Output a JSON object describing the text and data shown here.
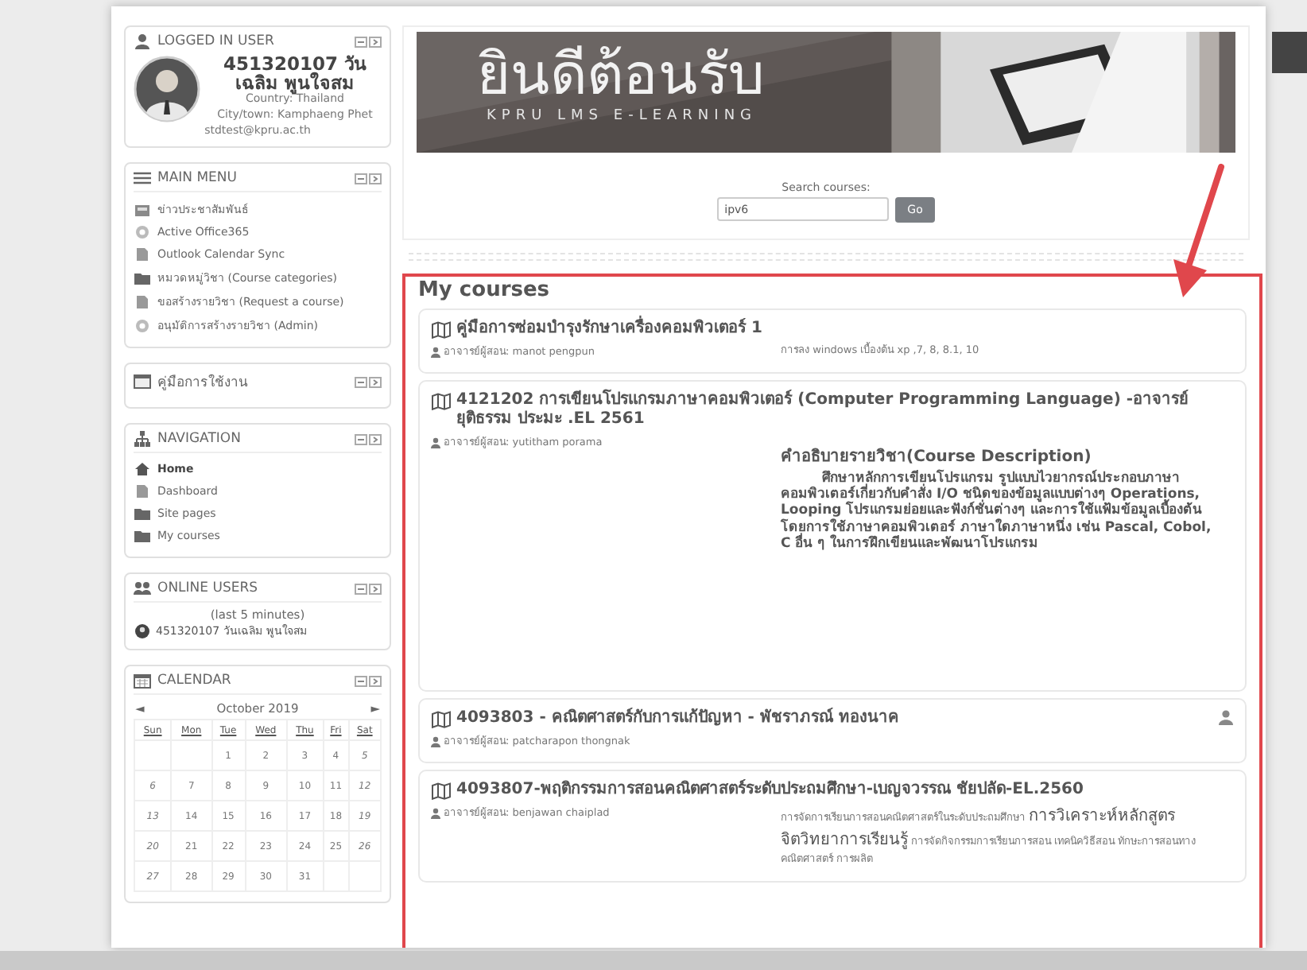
{
  "user_block": {
    "title": "LOGGED IN USER",
    "name": "451320107 วันเฉลิม พูนใจสม",
    "country": "Country: Thailand",
    "city": "City/town: Kamphaeng Phet",
    "email": "stdtest@kpru.ac.th"
  },
  "main_menu": {
    "title": "MAIN MENU",
    "items": [
      {
        "label": "ข่าวประชาสัมพันธ์",
        "kind": "news"
      },
      {
        "label": "Active Office365",
        "kind": "link"
      },
      {
        "label": "Outlook Calendar Sync",
        "kind": "page"
      },
      {
        "label": "หมวดหมู่วิชา (Course categories)",
        "kind": "folder"
      },
      {
        "label": "ขอสร้างรายวิชา (Request a course)",
        "kind": "page"
      },
      {
        "label": "อนุมัติการสร้างรายวิชา (Admin)",
        "kind": "link"
      }
    ]
  },
  "manual_block": {
    "title": "คู่มือการใช้งาน"
  },
  "navigation": {
    "title": "NAVIGATION",
    "items": [
      {
        "label": "Home",
        "kind": "home",
        "selected": true
      },
      {
        "label": "Dashboard",
        "kind": "page",
        "selected": false
      },
      {
        "label": "Site pages",
        "kind": "folder",
        "selected": false
      },
      {
        "label": "My courses",
        "kind": "folder",
        "selected": false
      }
    ]
  },
  "online_users": {
    "title": "ONLINE USERS",
    "period": "(last 5 minutes)",
    "users": [
      "451320107 วันเฉลิม พูนใจสม"
    ]
  },
  "calendar": {
    "title": "CALENDAR",
    "prev": "◄",
    "month": "October 2019",
    "next": "►",
    "weekdays": [
      "Sun",
      "Mon",
      "Tue",
      "Wed",
      "Thu",
      "Fri",
      "Sat"
    ],
    "weeks": [
      {
        "starts_midweek": true,
        "days": [
          "1",
          "2",
          "3",
          "4",
          "5"
        ]
      },
      {
        "days": [
          "6",
          "7",
          "8",
          "9",
          "10",
          "11",
          "12"
        ]
      },
      {
        "days": [
          "13",
          "14",
          "15",
          "16",
          "17",
          "18",
          "19"
        ]
      },
      {
        "days": [
          "20",
          "21",
          "22",
          "23",
          "24",
          "25",
          "26"
        ]
      },
      {
        "starts_midweek": false,
        "days": [
          "27",
          "28",
          "29",
          "30",
          "31"
        ]
      }
    ]
  },
  "banner": {
    "title": "ยินดีต้อนรับ",
    "subtitle": "KPRU LMS E-LEARNING"
  },
  "search": {
    "label": "Search courses:",
    "value": "ipv6",
    "button": "Go"
  },
  "my_courses": {
    "heading": "My courses",
    "courses": [
      {
        "title": "คู่มือการซ่อมบำรุงรักษาเครื่องคอมพิวเตอร์ 1",
        "teacher": "อาจารย์ผู้สอน: manot pengpun",
        "person_icon": false,
        "summary": [
          {
            "kind": "note",
            "text": "การลง windows เบื้องต้น xp ,7, 8, 8.1, 10"
          }
        ]
      },
      {
        "title": "4121202 การเขียนโปรแกรมภาษาคอมพิวเตอร์ (Computer Programming Language) -อาจารย์ยุติธรรม ประมะ .EL 2561",
        "teacher": "อาจารย์ผู้สอน: yutitham porama",
        "person_icon": false,
        "summary": [
          {
            "kind": "heading",
            "text": "คำอธิบายรายวิชา(Course Description)"
          },
          {
            "kind": "body",
            "text": "ศึกษาหลักการเขียนโปรแกรม รูปแบบไวยากรณ์ประกอบภาษาคอมพิวเตอร์เกี่ยวกับคำสั่ง I/O ชนิดของข้อมูลแบบต่างๆ Operations, Looping โปรแกรมย่อยและฟังก์ชั่นต่างๆ และการใช้แฟ้มข้อมูลเบื้องต้น โดยการใช้ภาษาคอมพิวเตอร์ ภาษาใดภาษาหนึ่ง เช่น Pascal, Cobol, C อื่น ๆ ในการฝึกเขียนและพัฒนาโปรแกรม"
          }
        ]
      },
      {
        "title": "4093803 - คณิตศาสตร์กับการแก้ปัญหา - พัชราภรณ์ ทองนาค",
        "teacher": "อาจารย์ผู้สอน: patcharapon thongnak",
        "person_icon": true
      },
      {
        "title": "4093807-พฤติกรรมการสอนคณิตศาสตร์ระดับประถมศึกษา-เบญจวรรณ ชัยปลัด-EL.2560",
        "teacher": "อาจารย์ผู้สอน: benjawan chaiplad",
        "person_icon": false,
        "summary": [
          {
            "kind": "note",
            "text": "การจัดการเรียนการสอนคณิตศาสตร์ในระดับประถมศึกษา **การวิเคราะห์หลักสูตร จิตวิทยาการเรียนรู้** การจัดกิจกรรมการเรียนการสอน เทคนิควิธีสอน ทักษะการสอนทางคณิตศาสตร์ การผลิต"
          }
        ]
      }
    ]
  }
}
